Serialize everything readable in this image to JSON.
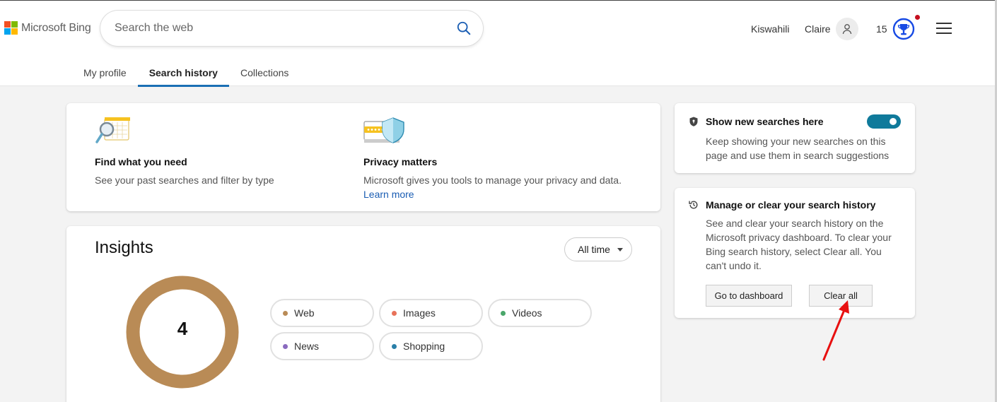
{
  "brand": {
    "name": "Microsoft Bing"
  },
  "search": {
    "placeholder": "Search the web"
  },
  "header": {
    "language": "Kiswahili",
    "user_name": "Claire",
    "rewards_points": "15"
  },
  "tabs": [
    {
      "label": "My profile",
      "active": false
    },
    {
      "label": "Search history",
      "active": true
    },
    {
      "label": "Collections",
      "active": false
    }
  ],
  "intro": {
    "find": {
      "title": "Find what you need",
      "desc": "See your past searches and filter by type"
    },
    "privacy": {
      "title": "Privacy matters",
      "desc": "Microsoft gives you tools to manage your privacy and data.",
      "link": "Learn more"
    }
  },
  "insights": {
    "title": "Insights",
    "time_filter": "All time",
    "total": "4",
    "donut_color": "#b98b56",
    "categories": [
      {
        "label": "Web",
        "color": "#b98b56"
      },
      {
        "label": "Images",
        "color": "#e8725a"
      },
      {
        "label": "Videos",
        "color": "#4aa66a"
      },
      {
        "label": "News",
        "color": "#8a6abf"
      },
      {
        "label": "Shopping",
        "color": "#2a7fa8"
      }
    ]
  },
  "show_new": {
    "title": "Show new searches here",
    "desc": "Keep showing your new searches on this page and use them in search suggestions",
    "enabled": true
  },
  "manage": {
    "title": "Manage or clear your search history",
    "desc": "See and clear your search history on the Microsoft privacy dashboard. To clear your Bing search history, select Clear all. You can't undo it.",
    "dashboard_label": "Go to dashboard",
    "clear_label": "Clear all"
  }
}
